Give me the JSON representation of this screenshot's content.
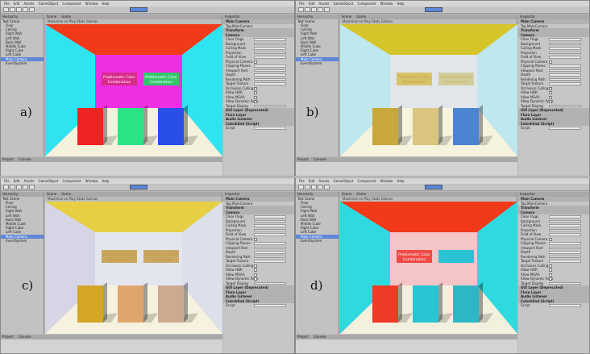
{
  "menu": [
    "File",
    "Edit",
    "Assets",
    "GameObject",
    "Component",
    "Window",
    "Help"
  ],
  "tabs": {
    "hierarchy": "Hierarchy",
    "scene": "Scene",
    "game": "Game",
    "inspector": "Inspector",
    "project": "Project",
    "console": "Console"
  },
  "game_bar": "Maximize on Play  Stats  Gizmos",
  "hierarchy_title": "Test Scene",
  "hierarchy_items": [
    "Floor",
    "Ceiling",
    "Right Wall",
    "Left Wall",
    "Back Wall",
    "Middle Cube",
    "Right Cube",
    "Left Cube",
    "Main Camera",
    "EventSystem"
  ],
  "inspector_rows": [
    {
      "label": "Main Camera",
      "head": true
    },
    {
      "label": "Tag  MainCamera"
    },
    {
      "label": "Transform",
      "head": true
    },
    {
      "label": "Camera",
      "head": true
    },
    {
      "label": "Clear Flags",
      "field": "val"
    },
    {
      "label": "Background",
      "field": "val"
    },
    {
      "label": "Culling Mask",
      "field": "val"
    },
    {
      "label": "Projection",
      "field": "val"
    },
    {
      "label": "Field of View",
      "field": "val"
    },
    {
      "label": "Physical Camera",
      "field": "chk"
    },
    {
      "label": "Clipping Planes",
      "field": "val"
    },
    {
      "label": "Viewport Rect",
      "field": "val"
    },
    {
      "label": "Depth",
      "field": "val"
    },
    {
      "label": "Rendering Path",
      "field": "val"
    },
    {
      "label": "Target Texture",
      "field": "val"
    },
    {
      "label": "Occlusion Culling",
      "field": "chk"
    },
    {
      "label": "Allow HDR",
      "field": "chk"
    },
    {
      "label": "Allow MSAA",
      "field": "chk"
    },
    {
      "label": "Allow Dynamic Reso",
      "field": "chk"
    },
    {
      "label": "Target Display",
      "field": "val"
    },
    {
      "label": "GUI Layer (Deprecated)",
      "head": true
    },
    {
      "label": "Flare Layer",
      "head": true
    },
    {
      "label": "Audio Listener",
      "head": true
    },
    {
      "label": "Colorblind (Script)",
      "head": true
    },
    {
      "label": "Script",
      "field": "val"
    }
  ],
  "panels": [
    {
      "label": "a)",
      "colors": {
        "ceiling": "#f03a1a",
        "left": "#2fe4f0",
        "right": "#2fe4f0",
        "back": "#ee2fe3",
        "floor": "#f4f1dc",
        "sign_left": "#d62c8a",
        "sign_right": "#33c76b",
        "cube_left": "#f02222",
        "cube_mid": "#2ae586",
        "cube_right": "#2a4ee8",
        "sign_text_left": "#ffffff",
        "sign_text_right": "#ffffff"
      },
      "sign_text": [
        "Problematic Color",
        "Combination"
      ]
    },
    {
      "label": "b)",
      "colors": {
        "ceiling": "#d6c52a",
        "left": "#bfe7ee",
        "right": "#bfe7ee",
        "back": "#e2e6ea",
        "floor": "#f6f3df",
        "sign_left": "#d6c26a",
        "sign_right": "#d2cd9e",
        "cube_left": "#c8a83a",
        "cube_mid": "#d9c57e",
        "cube_right": "#4b84d1",
        "sign_text_left": "#c1a13a",
        "sign_text_right": "#c8b25a"
      },
      "sign_text": [
        "Problematic Color",
        "Combination"
      ]
    },
    {
      "label": "c)",
      "colors": {
        "ceiling": "#e7cf43",
        "left": "#d6d5e6",
        "right": "#dbe0ea",
        "back": "#e3e6ef",
        "floor": "#f6f2df",
        "sign_left": "#c9a85e",
        "sign_right": "#c9a864",
        "cube_left": "#d4a626",
        "cube_mid": "#e1a56c",
        "cube_right": "#cda98f",
        "sign_text_left": "#c7903a",
        "sign_text_right": "#c7903a"
      },
      "sign_text": [
        "Problematic Color",
        "Combination"
      ]
    },
    {
      "label": "d)",
      "colors": {
        "ceiling": "#f03a1a",
        "left": "#2fd9e0",
        "right": "#2fd9e0",
        "back": "#f4c4c7",
        "floor": "#f3f0dd",
        "sign_left": "#f04a45",
        "sign_right": "#29c3d4",
        "cube_left": "#ee3b26",
        "cube_mid": "#2ac4d2",
        "cube_right": "#2cb7c4",
        "sign_text_left": "#ffffff",
        "sign_text_right": "#29c3d4"
      },
      "sign_text": [
        "Problematic Color",
        "Combination"
      ]
    }
  ]
}
